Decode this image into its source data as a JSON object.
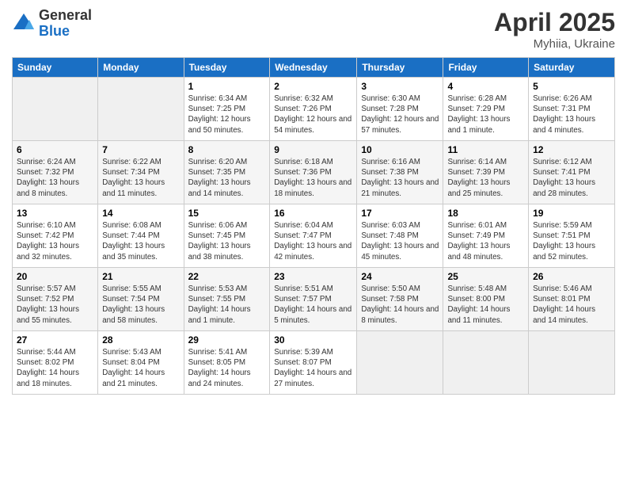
{
  "header": {
    "logo_general": "General",
    "logo_blue": "Blue",
    "title": "April 2025",
    "location": "Myhiia, Ukraine"
  },
  "days_of_week": [
    "Sunday",
    "Monday",
    "Tuesday",
    "Wednesday",
    "Thursday",
    "Friday",
    "Saturday"
  ],
  "weeks": [
    [
      {
        "day": "",
        "sunrise": "",
        "sunset": "",
        "daylight": ""
      },
      {
        "day": "",
        "sunrise": "",
        "sunset": "",
        "daylight": ""
      },
      {
        "day": "1",
        "sunrise": "Sunrise: 6:34 AM",
        "sunset": "Sunset: 7:25 PM",
        "daylight": "Daylight: 12 hours and 50 minutes."
      },
      {
        "day": "2",
        "sunrise": "Sunrise: 6:32 AM",
        "sunset": "Sunset: 7:26 PM",
        "daylight": "Daylight: 12 hours and 54 minutes."
      },
      {
        "day": "3",
        "sunrise": "Sunrise: 6:30 AM",
        "sunset": "Sunset: 7:28 PM",
        "daylight": "Daylight: 12 hours and 57 minutes."
      },
      {
        "day": "4",
        "sunrise": "Sunrise: 6:28 AM",
        "sunset": "Sunset: 7:29 PM",
        "daylight": "Daylight: 13 hours and 1 minute."
      },
      {
        "day": "5",
        "sunrise": "Sunrise: 6:26 AM",
        "sunset": "Sunset: 7:31 PM",
        "daylight": "Daylight: 13 hours and 4 minutes."
      }
    ],
    [
      {
        "day": "6",
        "sunrise": "Sunrise: 6:24 AM",
        "sunset": "Sunset: 7:32 PM",
        "daylight": "Daylight: 13 hours and 8 minutes."
      },
      {
        "day": "7",
        "sunrise": "Sunrise: 6:22 AM",
        "sunset": "Sunset: 7:34 PM",
        "daylight": "Daylight: 13 hours and 11 minutes."
      },
      {
        "day": "8",
        "sunrise": "Sunrise: 6:20 AM",
        "sunset": "Sunset: 7:35 PM",
        "daylight": "Daylight: 13 hours and 14 minutes."
      },
      {
        "day": "9",
        "sunrise": "Sunrise: 6:18 AM",
        "sunset": "Sunset: 7:36 PM",
        "daylight": "Daylight: 13 hours and 18 minutes."
      },
      {
        "day": "10",
        "sunrise": "Sunrise: 6:16 AM",
        "sunset": "Sunset: 7:38 PM",
        "daylight": "Daylight: 13 hours and 21 minutes."
      },
      {
        "day": "11",
        "sunrise": "Sunrise: 6:14 AM",
        "sunset": "Sunset: 7:39 PM",
        "daylight": "Daylight: 13 hours and 25 minutes."
      },
      {
        "day": "12",
        "sunrise": "Sunrise: 6:12 AM",
        "sunset": "Sunset: 7:41 PM",
        "daylight": "Daylight: 13 hours and 28 minutes."
      }
    ],
    [
      {
        "day": "13",
        "sunrise": "Sunrise: 6:10 AM",
        "sunset": "Sunset: 7:42 PM",
        "daylight": "Daylight: 13 hours and 32 minutes."
      },
      {
        "day": "14",
        "sunrise": "Sunrise: 6:08 AM",
        "sunset": "Sunset: 7:44 PM",
        "daylight": "Daylight: 13 hours and 35 minutes."
      },
      {
        "day": "15",
        "sunrise": "Sunrise: 6:06 AM",
        "sunset": "Sunset: 7:45 PM",
        "daylight": "Daylight: 13 hours and 38 minutes."
      },
      {
        "day": "16",
        "sunrise": "Sunrise: 6:04 AM",
        "sunset": "Sunset: 7:47 PM",
        "daylight": "Daylight: 13 hours and 42 minutes."
      },
      {
        "day": "17",
        "sunrise": "Sunrise: 6:03 AM",
        "sunset": "Sunset: 7:48 PM",
        "daylight": "Daylight: 13 hours and 45 minutes."
      },
      {
        "day": "18",
        "sunrise": "Sunrise: 6:01 AM",
        "sunset": "Sunset: 7:49 PM",
        "daylight": "Daylight: 13 hours and 48 minutes."
      },
      {
        "day": "19",
        "sunrise": "Sunrise: 5:59 AM",
        "sunset": "Sunset: 7:51 PM",
        "daylight": "Daylight: 13 hours and 52 minutes."
      }
    ],
    [
      {
        "day": "20",
        "sunrise": "Sunrise: 5:57 AM",
        "sunset": "Sunset: 7:52 PM",
        "daylight": "Daylight: 13 hours and 55 minutes."
      },
      {
        "day": "21",
        "sunrise": "Sunrise: 5:55 AM",
        "sunset": "Sunset: 7:54 PM",
        "daylight": "Daylight: 13 hours and 58 minutes."
      },
      {
        "day": "22",
        "sunrise": "Sunrise: 5:53 AM",
        "sunset": "Sunset: 7:55 PM",
        "daylight": "Daylight: 14 hours and 1 minute."
      },
      {
        "day": "23",
        "sunrise": "Sunrise: 5:51 AM",
        "sunset": "Sunset: 7:57 PM",
        "daylight": "Daylight: 14 hours and 5 minutes."
      },
      {
        "day": "24",
        "sunrise": "Sunrise: 5:50 AM",
        "sunset": "Sunset: 7:58 PM",
        "daylight": "Daylight: 14 hours and 8 minutes."
      },
      {
        "day": "25",
        "sunrise": "Sunrise: 5:48 AM",
        "sunset": "Sunset: 8:00 PM",
        "daylight": "Daylight: 14 hours and 11 minutes."
      },
      {
        "day": "26",
        "sunrise": "Sunrise: 5:46 AM",
        "sunset": "Sunset: 8:01 PM",
        "daylight": "Daylight: 14 hours and 14 minutes."
      }
    ],
    [
      {
        "day": "27",
        "sunrise": "Sunrise: 5:44 AM",
        "sunset": "Sunset: 8:02 PM",
        "daylight": "Daylight: 14 hours and 18 minutes."
      },
      {
        "day": "28",
        "sunrise": "Sunrise: 5:43 AM",
        "sunset": "Sunset: 8:04 PM",
        "daylight": "Daylight: 14 hours and 21 minutes."
      },
      {
        "day": "29",
        "sunrise": "Sunrise: 5:41 AM",
        "sunset": "Sunset: 8:05 PM",
        "daylight": "Daylight: 14 hours and 24 minutes."
      },
      {
        "day": "30",
        "sunrise": "Sunrise: 5:39 AM",
        "sunset": "Sunset: 8:07 PM",
        "daylight": "Daylight: 14 hours and 27 minutes."
      },
      {
        "day": "",
        "sunrise": "",
        "sunset": "",
        "daylight": ""
      },
      {
        "day": "",
        "sunrise": "",
        "sunset": "",
        "daylight": ""
      },
      {
        "day": "",
        "sunrise": "",
        "sunset": "",
        "daylight": ""
      }
    ]
  ]
}
